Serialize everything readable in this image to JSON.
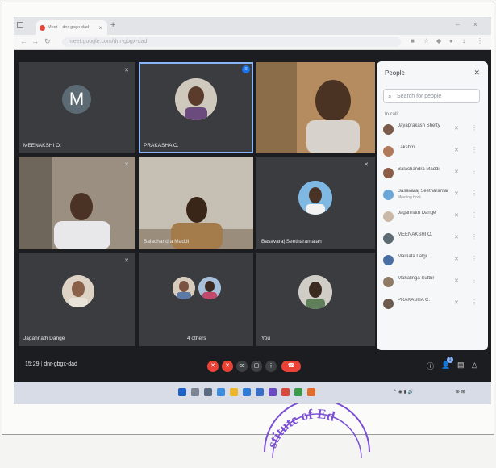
{
  "browser": {
    "tab_title": "Meet – dnr-gbgx-dad",
    "close_tab": "×",
    "new_tab": "+",
    "url": "meet.google.com/dnr-gbgx-dad"
  },
  "tiles": [
    {
      "name": "MEENAKSHI O.",
      "letter": "M",
      "avatar_color": "#5c6b73"
    },
    {
      "name": "PRAKASHA C.",
      "speaking": true
    },
    {
      "name": ""
    },
    {
      "name": ""
    },
    {
      "name": "Balachandra Maddi"
    },
    {
      "name": "Basavaraj Seetharamaiah"
    },
    {
      "name": "Jagannath Dange"
    },
    {
      "name": "4 others"
    },
    {
      "name": "You"
    }
  ],
  "people_panel": {
    "title": "People",
    "search_placeholder": "Search for people",
    "section_label": "In call",
    "participants": [
      {
        "name": "Jayaprakash Shetty",
        "sub": "",
        "color": "#7b5a4a"
      },
      {
        "name": "Lakshmi",
        "sub": "",
        "color": "#b07a5a"
      },
      {
        "name": "Balachandra Maddi",
        "sub": "",
        "color": "#8a5b46"
      },
      {
        "name": "Basavaraj Seetharamaiah",
        "sub": "Meeting host",
        "color": "#6aa6d6"
      },
      {
        "name": "Jagannath Dange",
        "sub": "",
        "color": "#c9b8a6"
      },
      {
        "name": "MEENAKSHI O.",
        "sub": "",
        "color": "#5c6b73"
      },
      {
        "name": "Mamata Lalgi",
        "sub": "",
        "color": "#4a6fa5"
      },
      {
        "name": "Mahalinga Suttur",
        "sub": "",
        "color": "#8f7a66"
      },
      {
        "name": "PRAKASHA C.",
        "sub": "",
        "color": "#6d5a4f"
      }
    ]
  },
  "controls": {
    "time": "15:29",
    "meeting_code": "dnr-gbgx-dad",
    "host_badge": "1"
  },
  "stamp_text": "stitute of Ed",
  "colors": {
    "red_button": "#ea4335",
    "speaking_ring": "#8ab4f8",
    "accent": "#1a73e8",
    "stamp": "#7b4fd3"
  }
}
